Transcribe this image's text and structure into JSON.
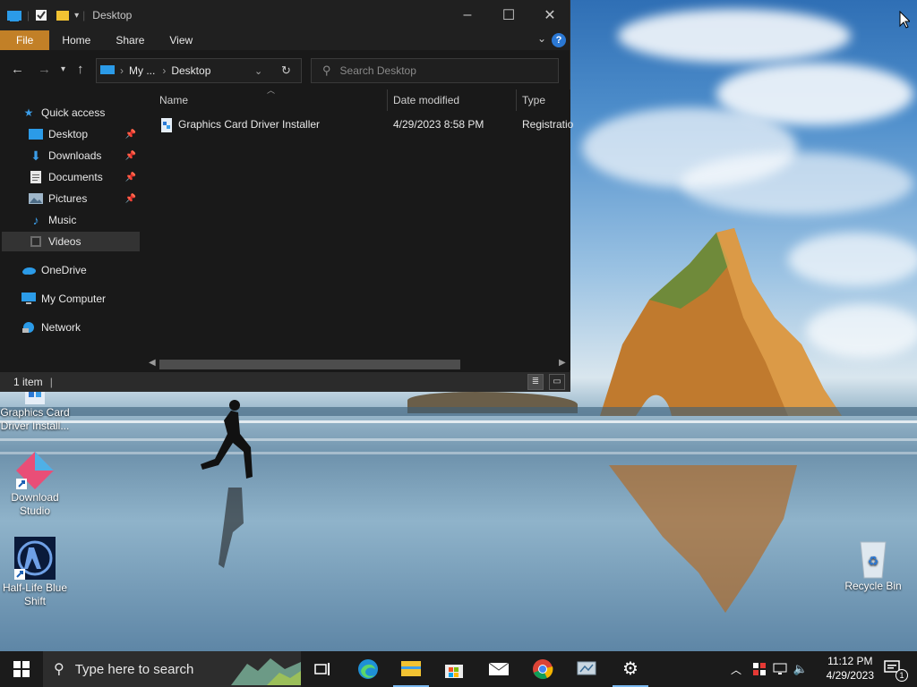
{
  "window": {
    "title": "Desktop",
    "ribbon_tabs": [
      "File",
      "Home",
      "Share",
      "View"
    ],
    "help_label": "?",
    "controls": {
      "minimize": "–",
      "maximize": "☐",
      "close": "✕"
    }
  },
  "address": {
    "crumb_short": "My ...",
    "crumb_current": "Desktop",
    "sep": "›"
  },
  "search": {
    "placeholder": "Search Desktop"
  },
  "sidebar": {
    "items": [
      {
        "label": "Quick access",
        "icon": "star-icon",
        "pinned": false
      },
      {
        "label": "Desktop",
        "icon": "desktop-folder-icon",
        "pinned": true
      },
      {
        "label": "Downloads",
        "icon": "download-arrow-icon",
        "pinned": true
      },
      {
        "label": "Documents",
        "icon": "document-icon",
        "pinned": true
      },
      {
        "label": "Pictures",
        "icon": "pictures-icon",
        "pinned": true
      },
      {
        "label": "Music",
        "icon": "music-note-icon",
        "pinned": false
      },
      {
        "label": "Videos",
        "icon": "video-icon",
        "pinned": false,
        "selected": true
      },
      {
        "label": "OneDrive",
        "icon": "cloud-icon",
        "pinned": false
      },
      {
        "label": "My Computer",
        "icon": "computer-icon",
        "pinned": false
      },
      {
        "label": "Network",
        "icon": "network-icon",
        "pinned": false
      }
    ]
  },
  "file_list": {
    "columns": [
      "Name",
      "Date modified",
      "Type"
    ],
    "rows": [
      {
        "name": "Graphics Card Driver Installer",
        "date_modified": "4/29/2023 8:58 PM",
        "type": "Registratio"
      }
    ]
  },
  "status": {
    "item_count": "1 item"
  },
  "desktop_icons": [
    {
      "label": "Graphics Card Driver Install...",
      "icon": "registry-file-icon"
    },
    {
      "label": "Download Studio",
      "icon": "download-studio-icon"
    },
    {
      "label": "Half-Life Blue Shift",
      "icon": "half-life-icon"
    },
    {
      "label": "Recycle Bin",
      "icon": "recycle-bin-icon"
    }
  ],
  "taskbar": {
    "search_placeholder": "Type here to search",
    "time": "11:12 PM",
    "date": "4/29/2023",
    "notification_count": "1"
  },
  "colors": {
    "file_tab": "#c28027",
    "accent_blue": "#2b78d4",
    "explorer_bg": "#191919",
    "taskbar_bg": "#1b1b1b"
  }
}
